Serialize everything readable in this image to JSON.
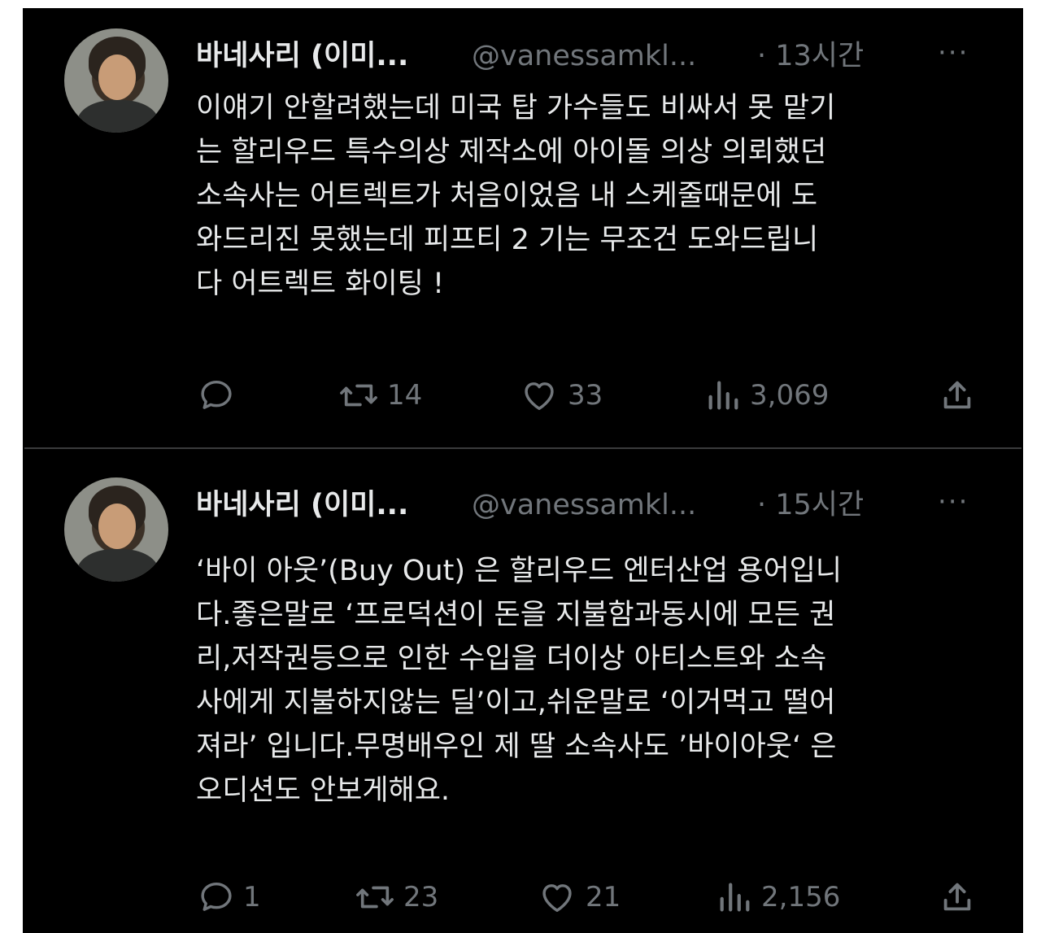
{
  "tweets": [
    {
      "display_name": "바네사리 (이미...",
      "handle": "@vanessamkl...",
      "time": "· 13시간",
      "more": "···",
      "text": "이얘기 안할려했는데 미국 탑 가수들도 비싸서 못 맡기\n는 할리우드 특수의상 제작소에 아이돌 의상 의뢰했던\n소속사는 어트렉트가 처음이었음 내 스케줄때문에 도\n와드리진 못했는데  피프티 2 기는 무조건 도와드립니\n다 어트렉트 화이팅 !",
      "replies": "",
      "retweets": "14",
      "likes": "33",
      "views": "3,069"
    },
    {
      "display_name": "바네사리 (이미...",
      "handle": "@vanessamkl...",
      "time": "· 15시간",
      "more": "···",
      "text": "‘바이 아웃’(Buy Out) 은 할리우드 엔터산업 용어입니\n다.좋은말로 ‘프로덕션이 돈을 지불함과동시에  모든 권\n리,저작권등으로 인한 수입을 더이상 아티스트와 소속\n사에게 지불하지않는 딜’이고,쉬운말로 ‘이거먹고 떨어\n져라’ 입니다.무명배우인 제 딸 소속사도 ’바이아웃‘ 은\n오디션도 안보게해요.",
      "replies": "1",
      "retweets": "23",
      "likes": "21",
      "views": "2,156"
    }
  ],
  "icons": {
    "reply": "reply-icon",
    "retweet": "retweet-icon",
    "like": "heart-icon",
    "views": "views-icon",
    "share": "share-icon"
  },
  "colors": {
    "background": "#000000",
    "text": "#e7e9ea",
    "secondary": "#71767b",
    "divider": "#3a3b3c"
  }
}
